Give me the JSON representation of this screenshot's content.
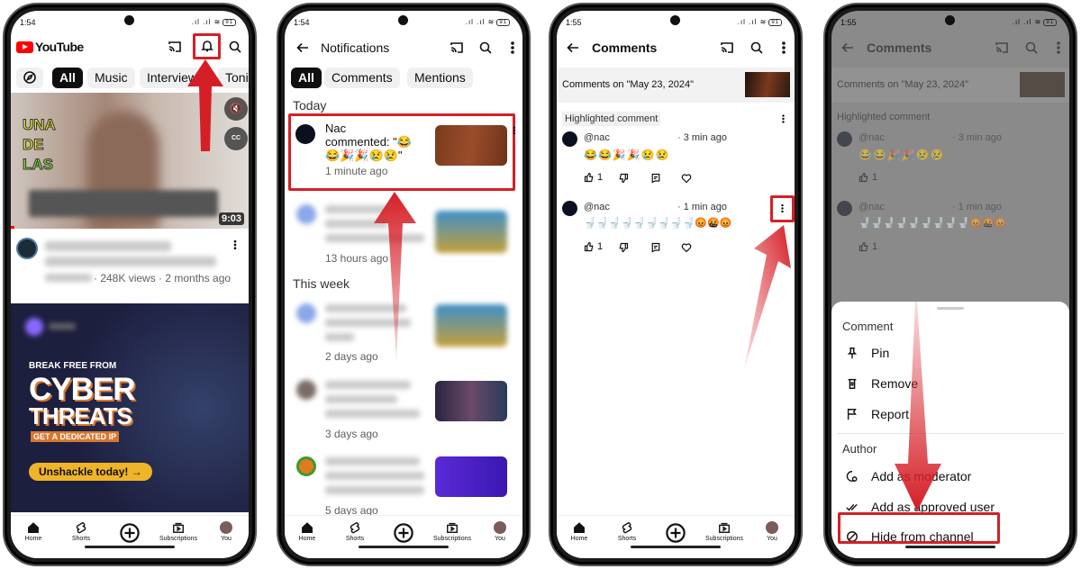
{
  "colors": {
    "accent_red": "#d51f26",
    "youtube_red": "#ff0000",
    "chip_active": "#0f0f0f",
    "ad_bg": "#1d1f3f",
    "ad_cta": "#f0b429"
  },
  "status": {
    "battery": "91"
  },
  "phone1": {
    "time": "1:54",
    "logo": "YouTube",
    "chips": [
      "All",
      "Music",
      "Interviews",
      "Toni"
    ],
    "video_duration": "9:03",
    "video_overlay_text": [
      "UNA",
      "DE",
      "LAS"
    ],
    "video_meta": "· 248K views · 2 months ago",
    "ad": {
      "line1": "BREAK FREE FROM",
      "line2": "CYBER",
      "line3": "THREATS",
      "badge": "GET A DEDICATED IP",
      "cta": "Unshackle today! →"
    }
  },
  "nav": {
    "home": "Home",
    "shorts": "Shorts",
    "subscriptions": "Subscriptions",
    "you": "You"
  },
  "phone2": {
    "time": "1:54",
    "title": "Notifications",
    "chips": [
      "All",
      "Comments",
      "Mentions"
    ],
    "today": "Today",
    "this_week": "This week",
    "highlight": {
      "name": "Nac",
      "text": "commented: \"😂",
      "text2": "😂🎉🎉😢😢\"",
      "time": "1 minute ago"
    },
    "items": [
      {
        "time": "13 hours ago"
      },
      {
        "time": "2 days ago"
      },
      {
        "time": "3 days ago"
      },
      {
        "time": "5 days ago"
      }
    ]
  },
  "comments": {
    "time": "1:55",
    "title": "Comments",
    "comments_on": "Comments on \"May 23, 2024\"",
    "highlighted_label": "Highlighted comment",
    "list": [
      {
        "author": "@nac",
        "time": "· 3 min ago",
        "text": "😂😂🎉🎉😢😢",
        "likes": "1"
      },
      {
        "author": "@nac",
        "time": "· 1 min ago",
        "text": "🚽🚽🚽🚽🚽🚽🚽🚽🚽😡🤬😡",
        "likes": "1"
      }
    ]
  },
  "sheet": {
    "comment_heading": "Comment",
    "pin": "Pin",
    "remove": "Remove",
    "report": "Report",
    "author_heading": "Author",
    "add_moderator": "Add as moderator",
    "add_approved": "Add as approved user",
    "hide": "Hide from channel"
  }
}
